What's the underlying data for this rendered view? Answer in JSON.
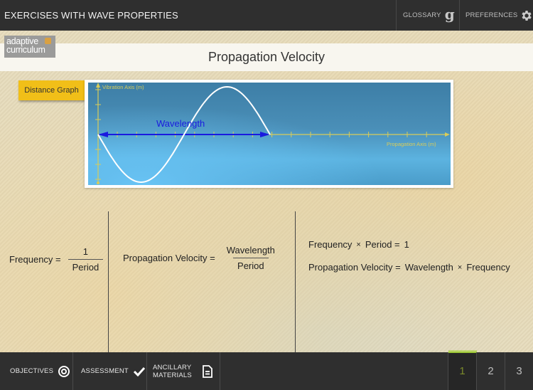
{
  "header": {
    "app_title": "EXERCISES WITH WAVE PROPERTIES",
    "glossary_label": "GLOSSARY",
    "glossary_icon": "g-glossary-icon",
    "preferences_label": "PREFERENCES",
    "preferences_icon": "gear-icon"
  },
  "logo": {
    "line1": "adaptive",
    "line2": "curriculum"
  },
  "page": {
    "title": "Propagation Velocity"
  },
  "graph": {
    "button_label": "Distance Graph",
    "y_axis_label": "Vibration Axis (m)",
    "x_axis_label": "Propagation Axis (m)",
    "wavelength_label": "Wavelength",
    "colors": {
      "axis": "#d8cc5a",
      "wave": "#ffffff",
      "arrow": "#1a1adf"
    }
  },
  "formulas": {
    "frequency": {
      "lhs": "Frequency =",
      "numerator": "1",
      "denominator": "Period"
    },
    "velocity": {
      "lhs": "Propagation Velocity =",
      "numerator": "Wavelength",
      "denominator": "Period"
    },
    "product": {
      "a": "Frequency",
      "times": "×",
      "b": "Period =",
      "c": "1"
    },
    "velocity_product": {
      "lhs": "Propagation Velocity =",
      "a": "Wavelength",
      "times": "×",
      "b": "Frequency"
    }
  },
  "footer": {
    "objectives_label": "OBJECTIVES",
    "objectives_icon": "target-icon",
    "assessment_label": "ASSESSMENT",
    "assessment_icon": "checkmark-icon",
    "ancillary_line1": "ANCILLARY",
    "ancillary_line2": "MATERIALS",
    "ancillary_icon": "document-icon",
    "pages": [
      "1",
      "2",
      "3"
    ],
    "active_page": "1"
  }
}
